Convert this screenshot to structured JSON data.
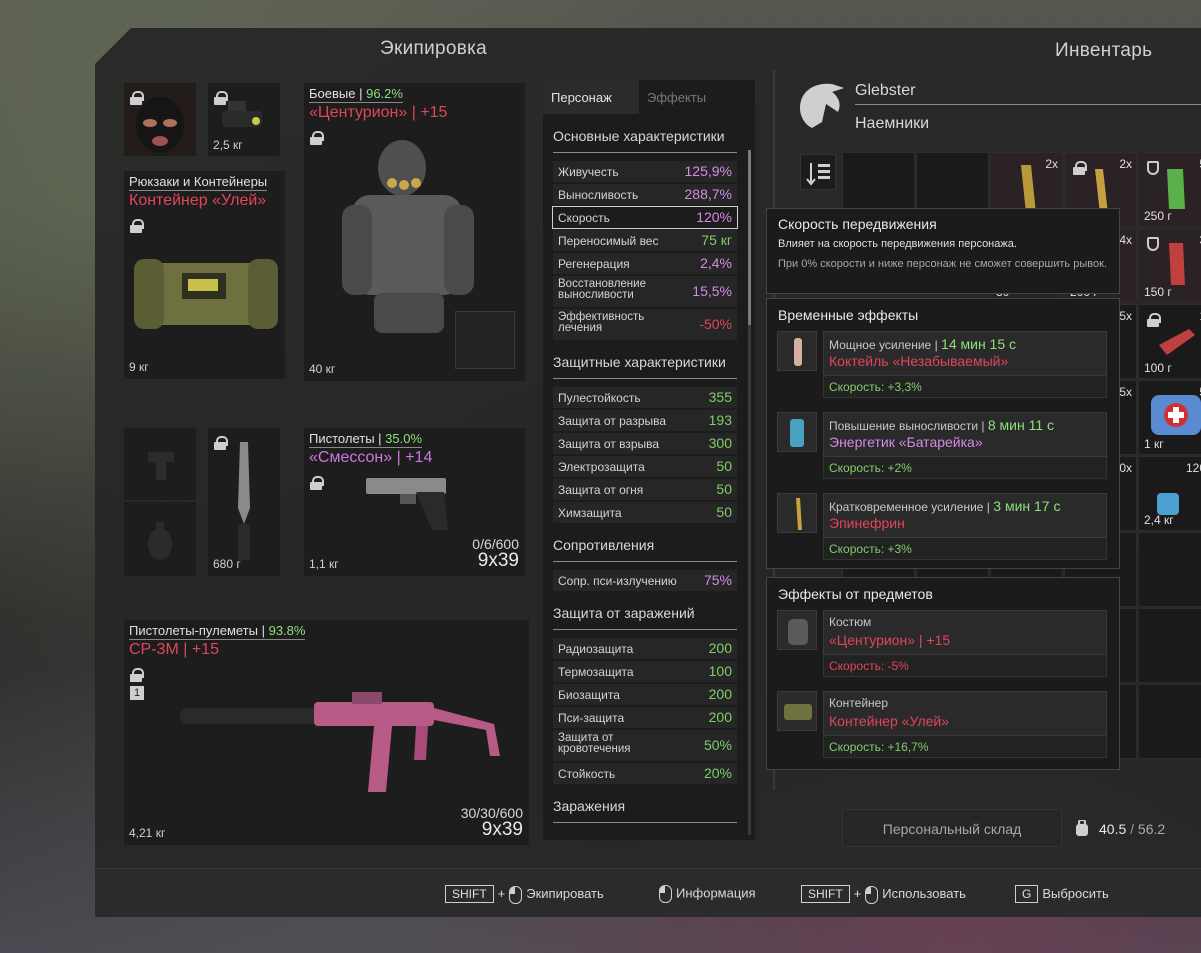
{
  "titles": {
    "equipment": "Экипировка",
    "inventory": "Инвентарь"
  },
  "slots": {
    "helmet_weight": "2,5 кг",
    "armor": {
      "label": "Боевые",
      "pct": "96.2%",
      "name": "«Центурион» | +15",
      "weight": "40 кг"
    },
    "backpack": {
      "label": "Рюкзаки и Контейнеры",
      "name": "Контейнер «Улей»",
      "weight": "9 кг"
    },
    "knife_weight": "680 г",
    "pistol": {
      "label": "Пистолеты",
      "pct": "35.0%",
      "name": "«Смессон» | +14",
      "ammo": "0/6/600",
      "caliber": "9x39",
      "weight": "1,1 кг"
    },
    "smg": {
      "label": "Пистолеты-пулеметы",
      "pct": "93.8%",
      "name": "СР-3М | +15",
      "badge": "1",
      "ammo": "30/30/600",
      "caliber": "9x39",
      "weight": "4,21 кг"
    }
  },
  "stats": {
    "tabs": [
      "Персонаж",
      "Эффекты"
    ],
    "main_header": "Основные характеристики",
    "main": [
      {
        "k": "Живучесть",
        "v": "125,9%"
      },
      {
        "k": "Выносливость",
        "v": "288,7%"
      },
      {
        "k": "Скорость",
        "v": "120%"
      },
      {
        "k": "Переносимый вес",
        "v": "75 кг"
      },
      {
        "k": "Регенерация",
        "v": "2,4%"
      },
      {
        "k": "Восстановление выносливости",
        "v": "15,5%"
      },
      {
        "k": "Эффективность лечения",
        "v": "-50%"
      }
    ],
    "prot_header": "Защитные характеристики",
    "prot": [
      {
        "k": "Пулестойкость",
        "v": "355"
      },
      {
        "k": "Защита от разрыва",
        "v": "193"
      },
      {
        "k": "Защита от взрыва",
        "v": "300"
      },
      {
        "k": "Электрозащита",
        "v": "50"
      },
      {
        "k": "Защита от огня",
        "v": "50"
      },
      {
        "k": "Химзащита",
        "v": "50"
      }
    ],
    "res_header": "Сопротивления",
    "res": [
      {
        "k": "Сопр. пси-излучению",
        "v": "75%"
      }
    ],
    "inf_header": "Защита от заражений",
    "inf": [
      {
        "k": "Радиозащита",
        "v": "200"
      },
      {
        "k": "Термозащита",
        "v": "100"
      },
      {
        "k": "Биозащита",
        "v": "200"
      },
      {
        "k": "Пси-защита",
        "v": "200"
      },
      {
        "k": "Защита от кровотечения",
        "v": "50%"
      },
      {
        "k": "Стойкость",
        "v": "20%"
      }
    ],
    "contam_header": "Заражения"
  },
  "player": {
    "name": "Glebster",
    "faction": "Наемники"
  },
  "inventory": {
    "counts": [
      "2x",
      "2x",
      "5",
      "4x",
      "3",
      "5x",
      "1",
      "5x",
      "5",
      "0x",
      "120"
    ],
    "weights": [
      "250 г",
      "150 г",
      "100 г",
      "1 кг",
      "2,4 кг",
      "30",
      "200 г"
    ]
  },
  "tooltip": {
    "title": "Скорость передвижения",
    "desc": "Влияет на скорость передвижения персонажа.",
    "note": "При 0% скорости и ниже персонаж не сможет совершить рывок."
  },
  "temp_effects": {
    "header": "Временные эффекты",
    "items": [
      {
        "type": "Мощное усиление",
        "time": "14 мин 15 с",
        "name": "Коктейль «Незабываемый»",
        "effect": "Скорость: +3,3%"
      },
      {
        "type": "Повышение выносливости",
        "time": "8 мин 11 с",
        "name": "Энергетик «Батарейка»",
        "effect": "Скорость: +2%"
      },
      {
        "type": "Кратковременное усиление",
        "time": "3 мин 17 с",
        "name": "Эпинефрин",
        "effect": "Скорость: +3%"
      }
    ]
  },
  "item_effects": {
    "header": "Эффекты от предметов",
    "items": [
      {
        "type": "Костюм",
        "name": "«Центурион» | +15",
        "effect": "Скорость: -5%"
      },
      {
        "type": "Контейнер",
        "name": "Контейнер «Улей»",
        "effect": "Скорость: +16,7%"
      }
    ]
  },
  "storage": {
    "label": "Персональный склад",
    "weight_current": "40.5",
    "weight_sep": "/",
    "weight_max": "56.2"
  },
  "hints": {
    "shift": "SHIFT",
    "plus": "+",
    "equip": "Экипировать",
    "info": "Информация",
    "use": "Использовать",
    "g": "G",
    "drop": "Выбросить"
  }
}
